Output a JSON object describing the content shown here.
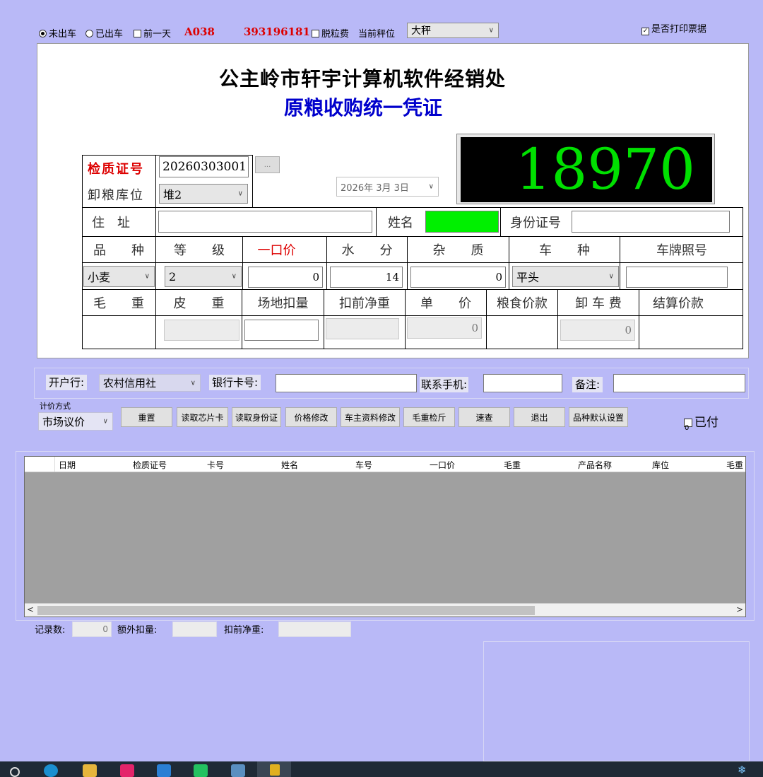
{
  "top_bar": {
    "radio_not_out": "未出车",
    "radio_out": "已出车",
    "prev_day": "前一天",
    "code": "A038",
    "number": "393196181",
    "dehull_fee": "脱粒费",
    "scale_label": "当前秤位",
    "scale_value": "大秤",
    "print_ticket": "是否打印票据"
  },
  "voucher": {
    "company": "公主岭市轩宇计算机软件经销处",
    "title": "原粮收购统一凭证",
    "weight_display": "18970",
    "cert_label": "检质证号",
    "cert_value": "20260303001",
    "browse": "...",
    "storage_label": "卸粮库位",
    "storage_value": "堆2",
    "date_value": "2026年  3月  3日",
    "address_label": "住　址",
    "name_label": "姓名",
    "id_label": "身份证号",
    "headers1": [
      "品　　种",
      "等　　级",
      "一口价",
      "水　　分",
      "杂　　质",
      "车　　种",
      "车牌照号"
    ],
    "variety_value": "小麦",
    "grade_value": "2",
    "fixed_price": "0",
    "moisture": "14",
    "impurity": "0",
    "vehicle_type": "平头",
    "headers2": [
      "毛　　重",
      "皮　　重",
      "场地扣量",
      "扣前净重",
      "单　　价",
      "粮食价款",
      "卸 车 费",
      "结算价款"
    ],
    "unit_price": "0",
    "unload_fee": "0"
  },
  "bank": {
    "bank_label": "开户行:",
    "bank_value": "农村信用社",
    "card_label": "银行卡号:",
    "phone_label": "联系手机:",
    "remark_label": "备注:"
  },
  "pricing": {
    "label": "计价方式",
    "value": "市场议价"
  },
  "buttons": [
    "重置",
    "读取芯片卡",
    "读取身份证",
    "价格修改",
    "车主资料修改",
    "毛重检斤",
    "速查",
    "退出",
    "品种默认设置"
  ],
  "paid": {
    "label": "已付",
    "value": "0"
  },
  "table": {
    "columns": [
      "日期",
      "检质证号",
      "卡号",
      "姓名",
      "车号",
      "一口价",
      "毛重",
      "产品名称",
      "库位",
      "毛重"
    ]
  },
  "footer": {
    "records_label": "记录数:",
    "records_value": "0",
    "extra_label": "额外扣量:",
    "net_label": "扣前净重:"
  },
  "colors": {
    "background": "#b9b9f7",
    "red_text": "#dd0000",
    "blue_title": "#0000cc",
    "led_green": "#00e000",
    "name_green": "#00f000"
  }
}
